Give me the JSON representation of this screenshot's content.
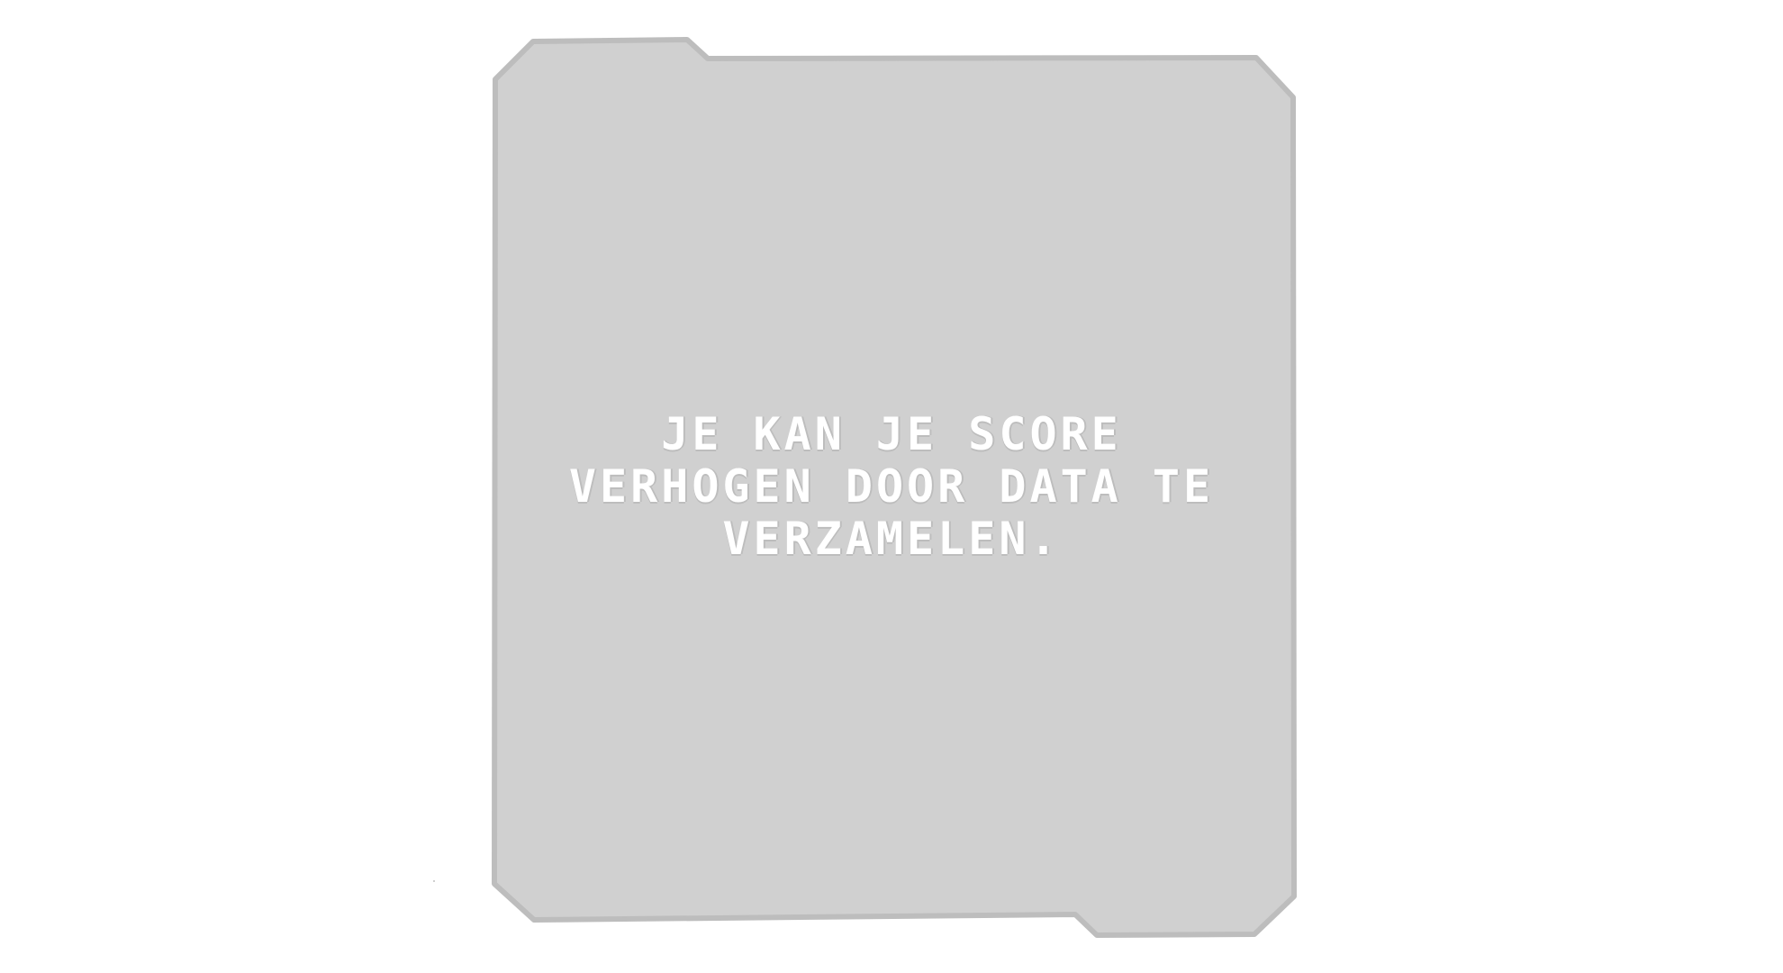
{
  "dialog": {
    "message": "JE KAN JE SCORE\nVERHOGEN DOOR DATA TE\nVERZAMELEN."
  },
  "colors": {
    "page_background": "#ffffff",
    "panel_fill": "#d0d0d0",
    "panel_border": "#bdbdbd",
    "text": "#ffffff"
  }
}
